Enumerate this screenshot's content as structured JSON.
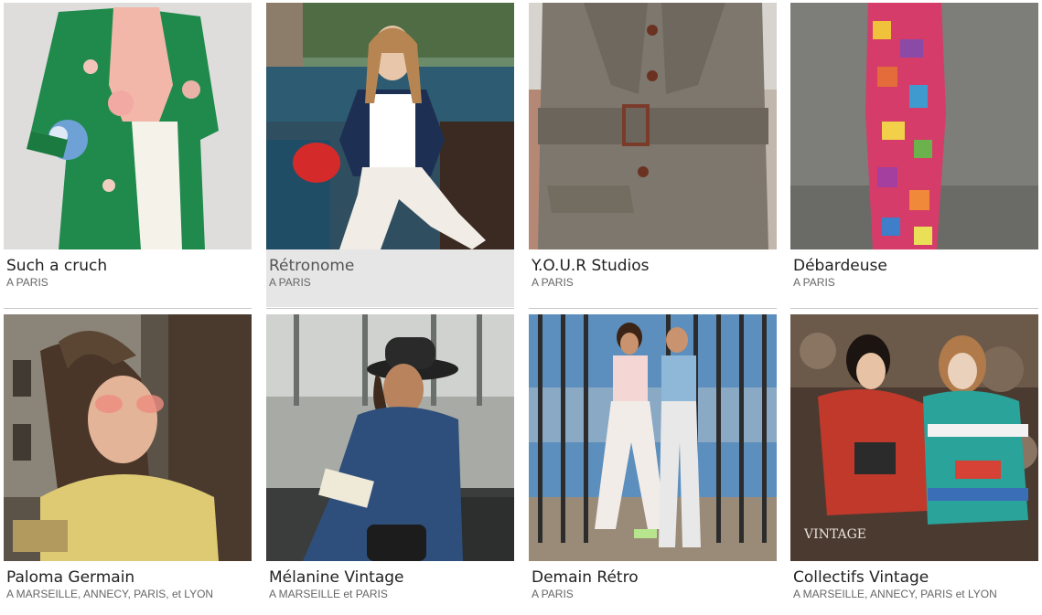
{
  "cards": [
    {
      "name": "Such a cruch",
      "location": "A PARIS"
    },
    {
      "name": "Rétronome",
      "location": "A PARIS"
    },
    {
      "name": "Y.O.U.R Studios",
      "location": "A PARIS"
    },
    {
      "name": "Débardeuse",
      "location": "A PARIS"
    },
    {
      "name": "Paloma Germain",
      "location": "A MARSEILLE, ANNECY, PARIS, et LYON"
    },
    {
      "name": "Mélanine Vintage",
      "location": "A MARSEILLE et PARIS"
    },
    {
      "name": "Demain Rétro",
      "location": "A PARIS"
    },
    {
      "name": "Collectifs Vintage",
      "location": "A MARSEILLE, ANNECY, PARIS et LYON"
    }
  ],
  "photo_text": {
    "sign": "VINTAGE"
  }
}
